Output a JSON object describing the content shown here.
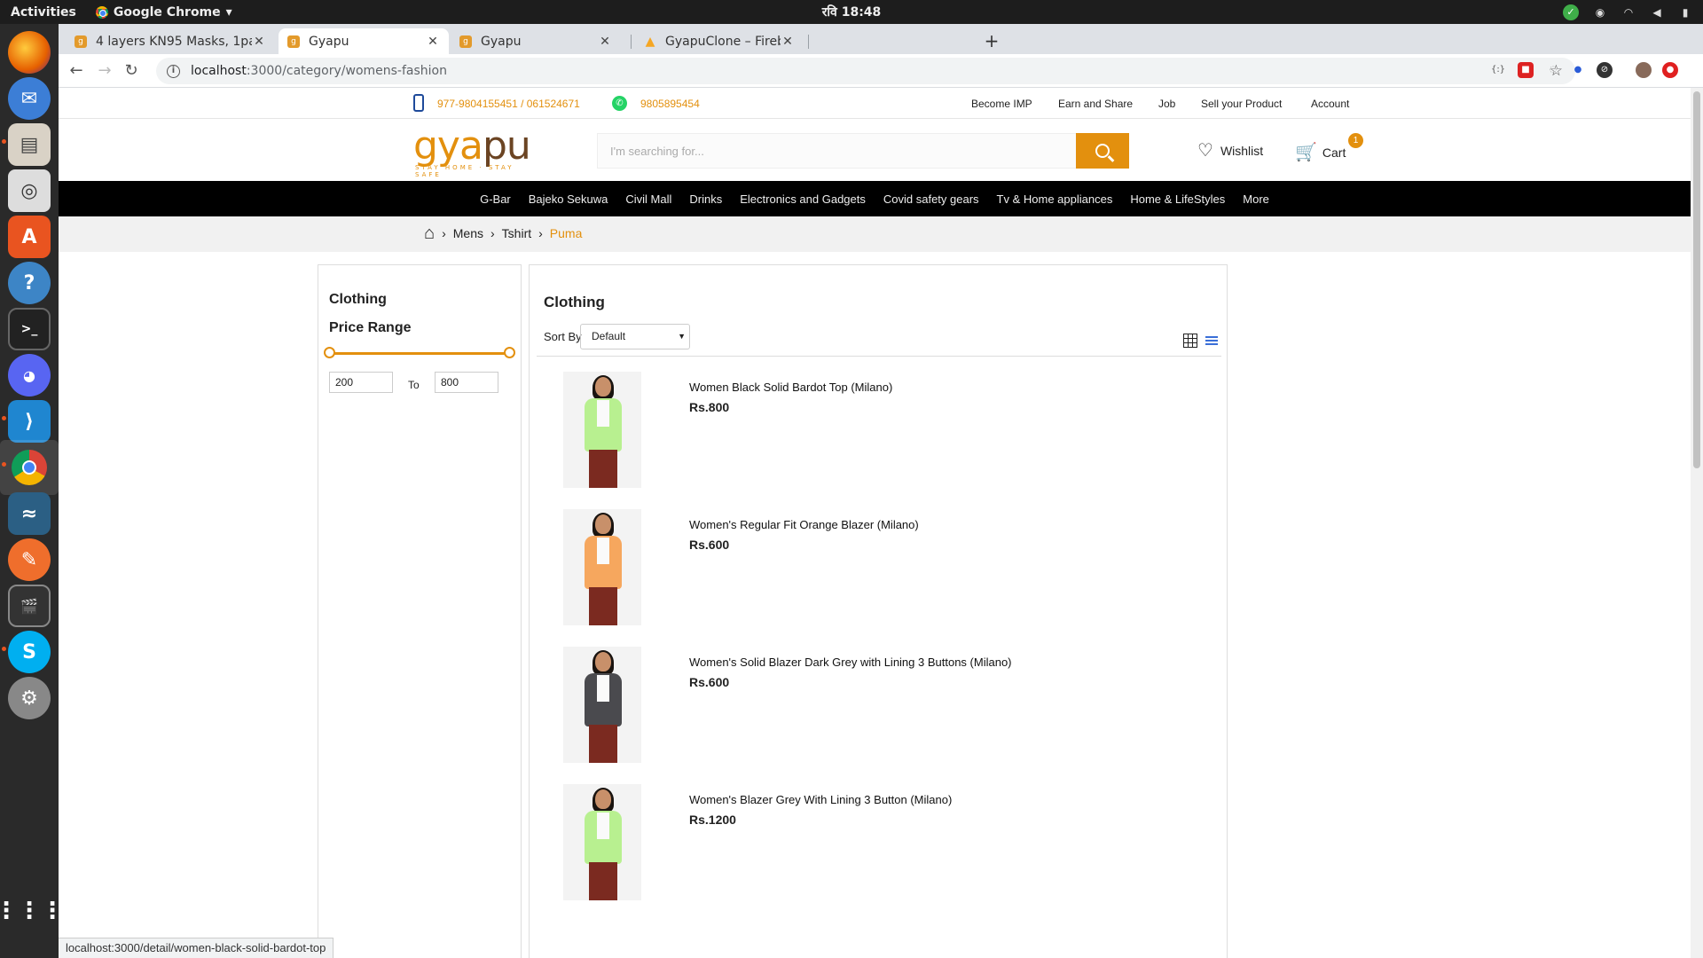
{
  "os": {
    "activities": "Activities",
    "app_name": "Google Chrome",
    "clock": "रवि 18:48"
  },
  "browser": {
    "tabs": [
      {
        "label": "4 layers KN95 Masks, 1pac",
        "active": false
      },
      {
        "label": "Gyapu",
        "active": true
      },
      {
        "label": "Gyapu",
        "active": false
      },
      {
        "label": "GyapuClone – Firebase co",
        "active": false
      }
    ],
    "url_host": "localhost",
    "url_path": ":3000/category/womens-fashion",
    "status_url": "localhost:3000/detail/women-black-solid-bardot-top"
  },
  "site": {
    "contact": {
      "phone": "977-9804155451 / 061524671",
      "whatsapp": "9805895454"
    },
    "top_links": [
      "Become IMP",
      "Earn and Share",
      "Job",
      "Sell your Product",
      "Account"
    ],
    "logo": {
      "part1": "gya",
      "part2": "pu",
      "tagline": "STAY HOME · STAY SAFE"
    },
    "search": {
      "placeholder": "I'm searching for..."
    },
    "wishlist_label": "Wishlist",
    "cart_label": "Cart",
    "cart_count": "1",
    "categories": [
      "G-Bar",
      "Bajeko Sekuwa",
      "Civil Mall",
      "Drinks",
      "Electronics and Gadgets",
      "Covid safety gears",
      "Tv & Home appliances",
      "Home & LifeStyles",
      "More"
    ],
    "breadcrumb": [
      "Mens",
      "Tshirt",
      "Puma"
    ]
  },
  "sidebar": {
    "title": "Clothing",
    "price_range_label": "Price Range",
    "min": "200",
    "max": "800",
    "to_label": "To"
  },
  "listing": {
    "title": "Clothing",
    "sort_label": "Sort By",
    "sort_value": "Default",
    "products": [
      {
        "name": "Women Black Solid Bardot Top (Milano)",
        "price": "Rs.800",
        "color": "#b8f090"
      },
      {
        "name": "Women's Regular Fit Orange Blazer (Milano)",
        "price": "Rs.600",
        "color": "#f6a75e"
      },
      {
        "name": "Women's Solid Blazer Dark Grey with Lining 3 Buttons (Milano)",
        "price": "Rs.600",
        "color": "#4a4a4e"
      },
      {
        "name": "Women's Blazer Grey With Lining 3 Button (Milano)",
        "price": "Rs.1200",
        "color": "#b8f090"
      }
    ]
  },
  "colors": {
    "accent": "#e3900e",
    "nav_bg": "#000000"
  }
}
